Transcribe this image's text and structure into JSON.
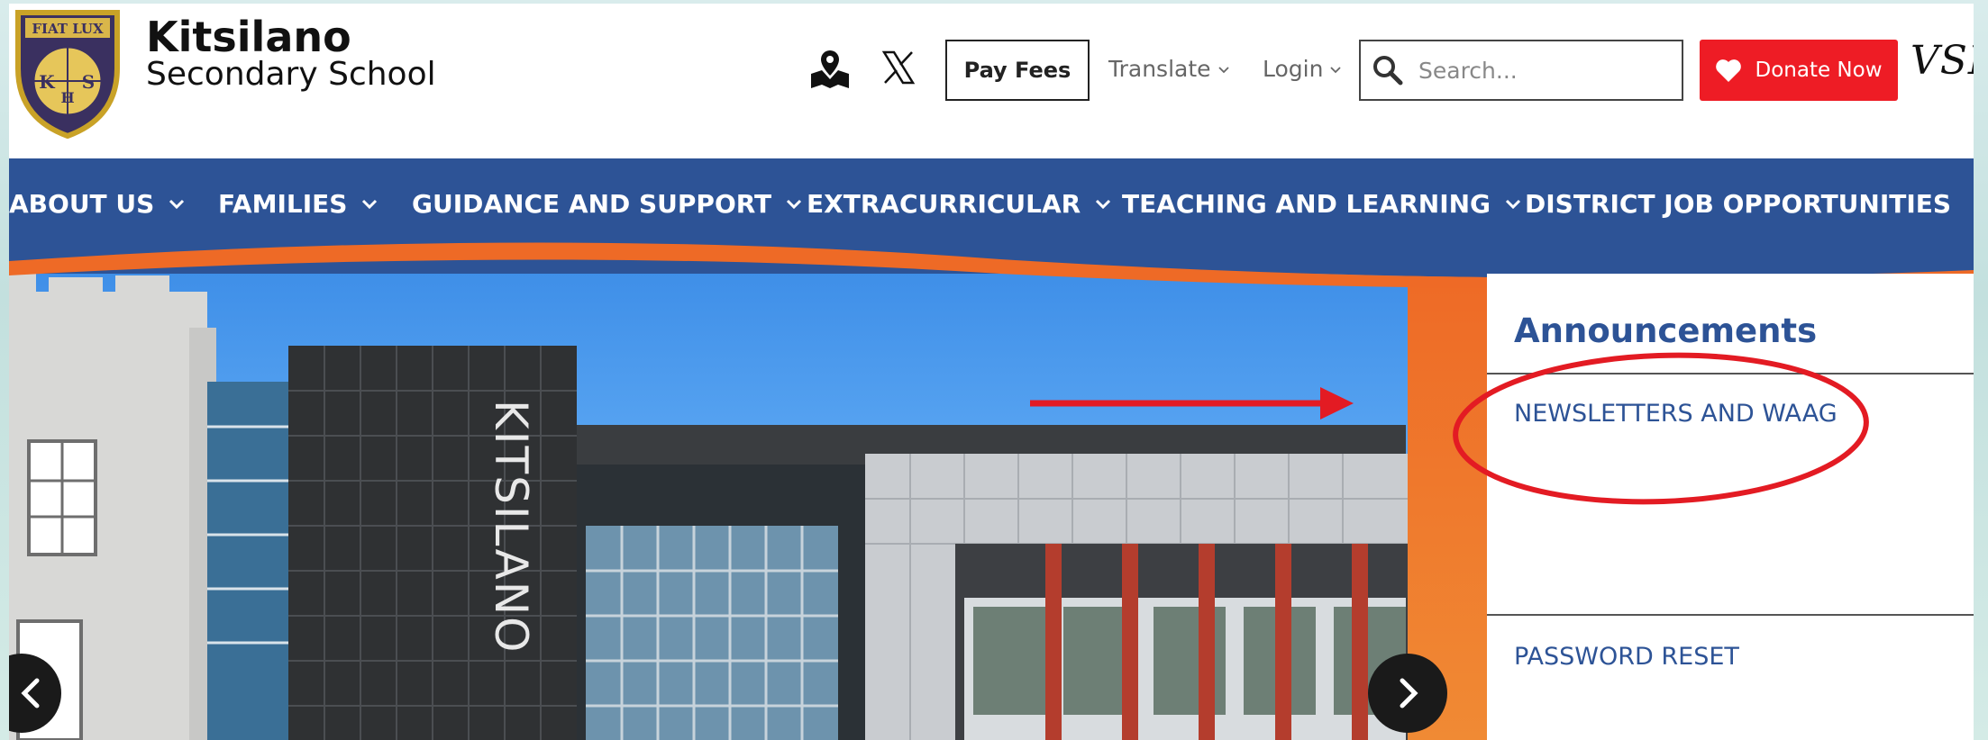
{
  "header": {
    "school_name": "Kitsilano",
    "school_subtitle": "Secondary School",
    "crest_motto": "FIAT LUX",
    "crest_initials": [
      "K",
      "H",
      "S"
    ],
    "pay_fees_label": "Pay Fees",
    "translate_label": "Translate",
    "login_label": "Login",
    "search_placeholder": "Search...",
    "donate_label": "Donate Now",
    "district_logo_text": "VSB"
  },
  "nav": {
    "items": [
      {
        "label": "ABOUT US",
        "has_dropdown": true
      },
      {
        "label": "FAMILIES",
        "has_dropdown": true
      },
      {
        "label": "GUIDANCE AND SUPPORT",
        "has_dropdown": true
      },
      {
        "label": "EXTRACURRICULAR",
        "has_dropdown": true
      },
      {
        "label": "TEACHING AND LEARNING",
        "has_dropdown": true
      },
      {
        "label": "DISTRICT JOB OPPORTUNITIES",
        "has_dropdown": false
      }
    ]
  },
  "hero": {
    "building_sign": "KITSILANO"
  },
  "announcements": {
    "title": "Announcements",
    "items": [
      {
        "label": "NEWSLETTERS AND WAAG"
      },
      {
        "label": "PASSWORD RESET"
      }
    ]
  },
  "colors": {
    "nav_blue": "#2d5396",
    "accent_orange": "#ee6a26",
    "donate_red": "#ee1c25",
    "annotation_red": "#e31b23"
  },
  "icons": {
    "map": "map-pin-icon",
    "x": "x-logo-icon",
    "search": "search-icon",
    "heart": "heart-icon",
    "prev": "chevron-left-icon",
    "next": "chevron-right-icon"
  }
}
